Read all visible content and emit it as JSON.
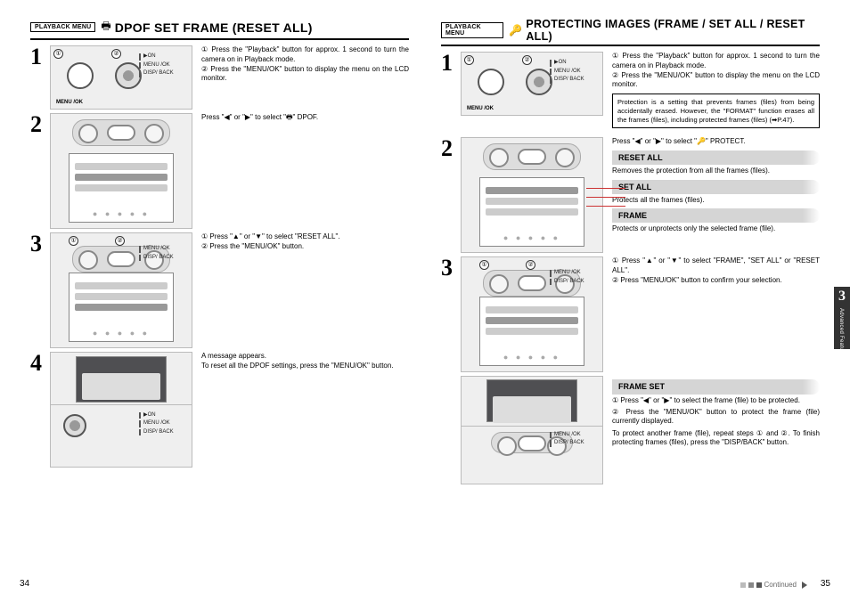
{
  "left": {
    "badge": "PLAYBACK MENU",
    "icon": "🖶",
    "title": "DPOF SET FRAME (RESET ALL)",
    "steps": {
      "s1": {
        "c1": "①",
        "c2": "②",
        "t1": "① Press the \"Playback\" button for approx. 1 second to turn the camera on in Playback mode.",
        "t2": "② Press the \"MENU/OK\" button to display the menu on the LCD monitor."
      },
      "s2": {
        "text": "Press \"◀\" or \"▶\" to select \"🖶\" DPOF."
      },
      "s3": {
        "c1": "①",
        "c2": "②",
        "t1": "① Press \"▲\" or \"▼\" to select \"RESET ALL\".",
        "t2": "② Press the \"MENU/OK\" button."
      },
      "s4": {
        "t1": "A message appears.",
        "t2": "To reset all the DPOF settings, press the \"MENU/OK\" button."
      }
    },
    "labels": {
      "on": "▶ON",
      "menu": "MENU\n/OK",
      "disp": "DISP/\nBACK",
      "menuok": "MENU\n/OK"
    },
    "page": "34"
  },
  "right": {
    "badge": "PLAYBACK MENU",
    "icon": "🔑",
    "title": "PROTECTING IMAGES (FRAME / SET ALL / RESET ALL)",
    "steps": {
      "s1": {
        "c1": "①",
        "c2": "②",
        "t1": "① Press the \"Playback\" button for approx. 1 second to turn the camera on in Playback mode.",
        "t2": "② Press the \"MENU/OK\" button to display the menu on the LCD monitor."
      },
      "s2": {
        "text": "Press \"◀\" or \"▶\" to select \"🔑\" PROTECT."
      },
      "s3": {
        "c1": "①",
        "c2": "②",
        "t1": "① Press \"▲\" or \"▼\" to select \"FRAME\", \"SET ALL\" or \"RESET ALL\".",
        "t2": "② Press \"MENU/OK\" button to confirm your selection."
      }
    },
    "note": "Protection is a setting that prevents frames (files) from being accidentally erased. However, the \"FORMAT\" function erases all the frames (files), including protected frames (files) (➡P.47).",
    "subs": {
      "reset_h": "RESET ALL",
      "reset_t": "Removes the protection from all the frames (files).",
      "setall_h": "SET ALL",
      "setall_t": "Protects all the frames (files).",
      "frame_h": "FRAME",
      "frame_t": "Protects or unprotects only the selected frame (file).",
      "fset_h": "FRAME SET",
      "fset_t1": "① Press \"◀\" or \"▶\" to select the frame (file) to be protected.",
      "fset_t2": "② Press the \"MENU/OK\" button to protect the frame (file) currently displayed.",
      "fset_t3": "To protect another frame (file), repeat steps ① and ②. To finish protecting frames (files), press the \"DISP/BACK\" button."
    },
    "tab": {
      "num": "3",
      "label": "Advanced Features"
    },
    "continued": "Continued",
    "page": "35"
  }
}
